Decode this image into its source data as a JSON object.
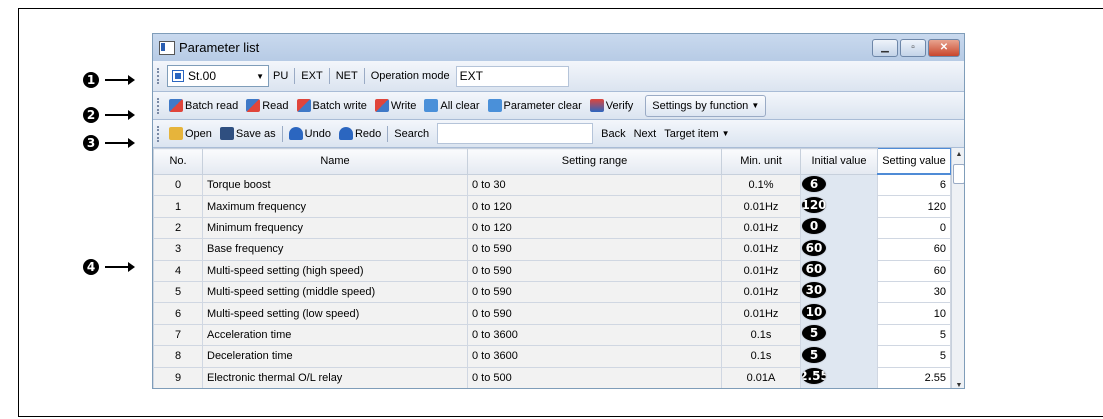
{
  "callouts": [
    "1",
    "2",
    "3",
    "4"
  ],
  "window": {
    "title": "Parameter list"
  },
  "toolbar1": {
    "station": "St.00",
    "pu": "PU",
    "ext": "EXT",
    "net": "NET",
    "mode_label": "Operation mode",
    "mode_value": "EXT"
  },
  "toolbar2": {
    "batch_read": "Batch read",
    "read": "Read",
    "batch_write": "Batch write",
    "write": "Write",
    "all_clear": "All clear",
    "parameter_clear": "Parameter clear",
    "verify": "Verify",
    "settings_by_function": "Settings by function"
  },
  "toolbar3": {
    "open": "Open",
    "save_as": "Save as",
    "undo": "Undo",
    "redo": "Redo",
    "search_label": "Search",
    "search_value": "",
    "back": "Back",
    "next": "Next",
    "target_item": "Target item"
  },
  "table": {
    "headers": [
      "No.",
      "Name",
      "Setting range",
      "Min. unit",
      "Initial value",
      "Setting value"
    ],
    "rows": [
      [
        "0",
        "Torque boost",
        "0 to 30",
        "0.1%",
        "6",
        "6"
      ],
      [
        "1",
        "Maximum frequency",
        "0 to 120",
        "0.01Hz",
        "120",
        "120"
      ],
      [
        "2",
        "Minimum frequency",
        "0 to 120",
        "0.01Hz",
        "0",
        "0"
      ],
      [
        "3",
        "Base frequency",
        "0 to 590",
        "0.01Hz",
        "60",
        "60"
      ],
      [
        "4",
        "Multi-speed setting (high speed)",
        "0 to 590",
        "0.01Hz",
        "60",
        "60"
      ],
      [
        "5",
        "Multi-speed setting (middle speed)",
        "0 to 590",
        "0.01Hz",
        "30",
        "30"
      ],
      [
        "6",
        "Multi-speed setting (low speed)",
        "0 to 590",
        "0.01Hz",
        "10",
        "10"
      ],
      [
        "7",
        "Acceleration time",
        "0 to 3600",
        "0.1s",
        "5",
        "5"
      ],
      [
        "8",
        "Deceleration time",
        "0 to 3600",
        "0.1s",
        "5",
        "5"
      ],
      [
        "9",
        "Electronic thermal O/L relay",
        "0 to 500",
        "0.01A",
        "2.55",
        "2.55"
      ]
    ]
  }
}
